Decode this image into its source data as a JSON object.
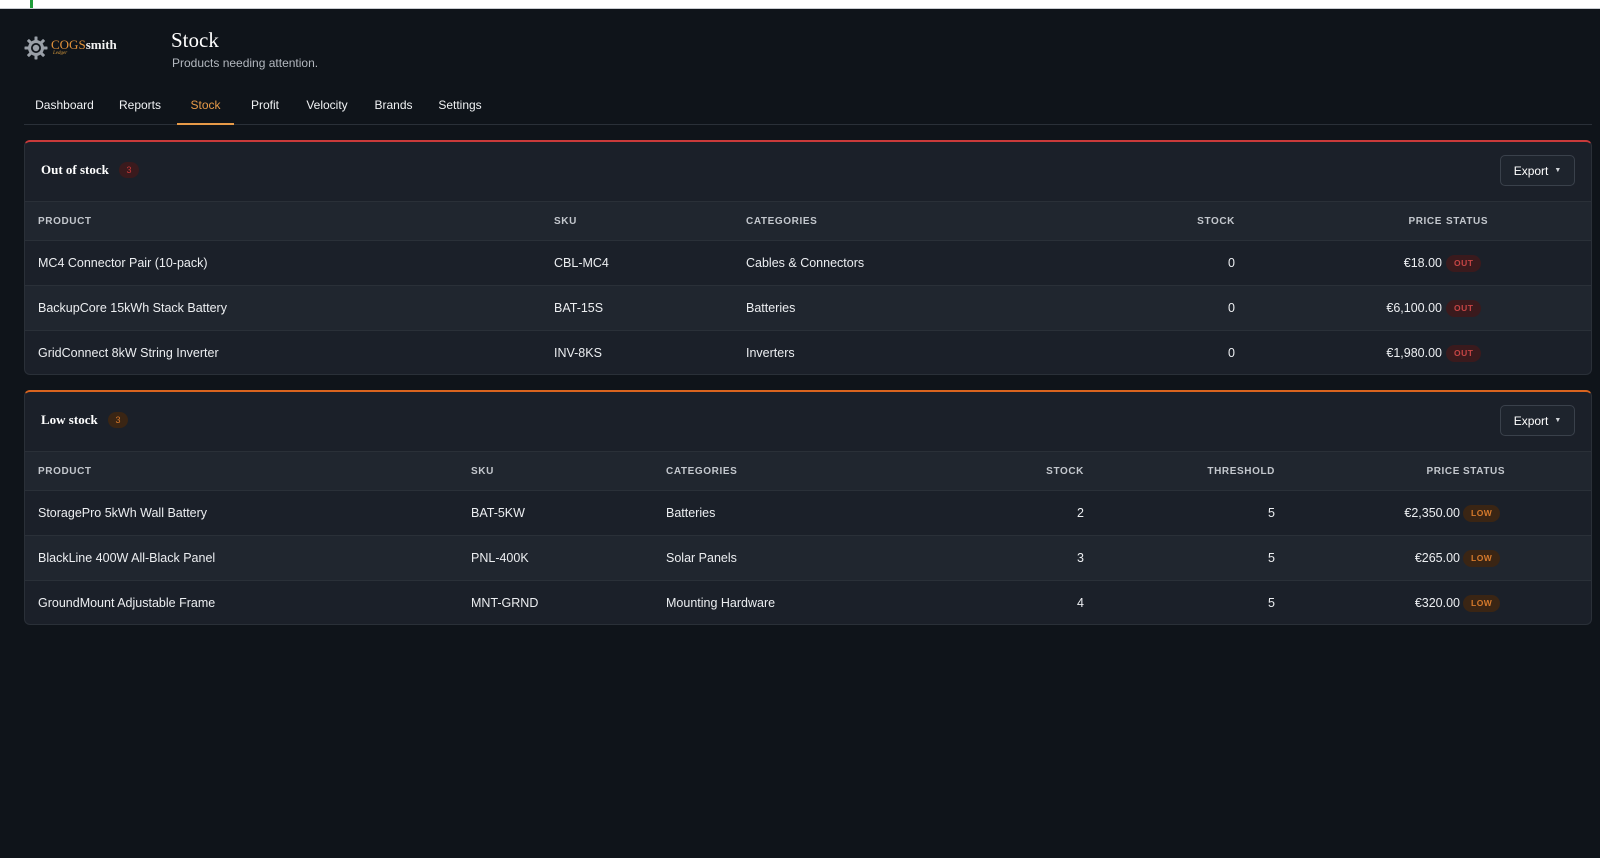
{
  "app": {
    "logo_primary": "COGS",
    "logo_secondary": "smith",
    "logo_tagline": "Ledger"
  },
  "page": {
    "title": "Stock",
    "subtitle": "Products needing attention."
  },
  "nav": {
    "tabs": [
      {
        "label": "Dashboard",
        "active": false
      },
      {
        "label": "Reports",
        "active": false
      },
      {
        "label": "Stock",
        "active": true
      },
      {
        "label": "Profit",
        "active": false
      },
      {
        "label": "Velocity",
        "active": false
      },
      {
        "label": "Brands",
        "active": false
      },
      {
        "label": "Settings",
        "active": false
      }
    ]
  },
  "colors": {
    "accent": "#e79a48",
    "out_border": "#c93a3a",
    "low_border": "#d9641f",
    "background": "#0f141a",
    "panel": "#1b2029"
  },
  "out_of_stock": {
    "title": "Out of stock",
    "count": "3",
    "export_label": "Export",
    "export_icon": "caret-down-icon",
    "columns": {
      "product": "PRODUCT",
      "sku": "SKU",
      "categories": "CATEGORIES",
      "stock": "STOCK",
      "price": "PRICE",
      "status": "STATUS"
    },
    "rows": [
      {
        "product": "MC4 Connector Pair (10-pack)",
        "sku": "CBL-MC4",
        "categories": "Cables & Connectors",
        "stock": "0",
        "price": "€18.00",
        "status": "OUT"
      },
      {
        "product": "BackupCore 15kWh Stack Battery",
        "sku": "BAT-15S",
        "categories": "Batteries",
        "stock": "0",
        "price": "€6,100.00",
        "status": "OUT"
      },
      {
        "product": "GridConnect 8kW String Inverter",
        "sku": "INV-8KS",
        "categories": "Inverters",
        "stock": "0",
        "price": "€1,980.00",
        "status": "OUT"
      }
    ]
  },
  "low_stock": {
    "title": "Low stock",
    "count": "3",
    "export_label": "Export",
    "export_icon": "caret-down-icon",
    "columns": {
      "product": "PRODUCT",
      "sku": "SKU",
      "categories": "CATEGORIES",
      "stock": "STOCK",
      "threshold": "THRESHOLD",
      "price": "PRICE",
      "status": "STATUS"
    },
    "rows": [
      {
        "product": "StoragePro 5kWh Wall Battery",
        "sku": "BAT-5KW",
        "categories": "Batteries",
        "stock": "2",
        "threshold": "5",
        "price": "€2,350.00",
        "status": "LOW"
      },
      {
        "product": "BlackLine 400W All-Black Panel",
        "sku": "PNL-400K",
        "categories": "Solar Panels",
        "stock": "3",
        "threshold": "5",
        "price": "€265.00",
        "status": "LOW"
      },
      {
        "product": "GroundMount Adjustable Frame",
        "sku": "MNT-GRND",
        "categories": "Mounting Hardware",
        "stock": "4",
        "threshold": "5",
        "price": "€320.00",
        "status": "LOW"
      }
    ]
  }
}
